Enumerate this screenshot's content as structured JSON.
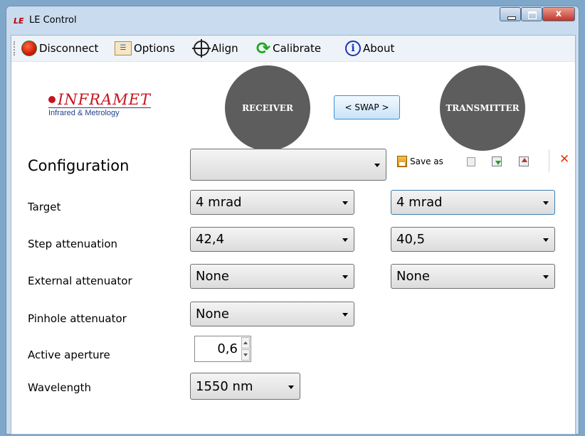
{
  "window": {
    "icon_text": "LE",
    "title": "LE Control"
  },
  "toolbar": {
    "disconnect_label": "Disconnect",
    "options_label": "Options",
    "align_label": "Align",
    "calibrate_label": "Calibrate",
    "about_label": "About",
    "about_icon_glyph": "i"
  },
  "logo": {
    "name": "INFRAMET",
    "tagline": "Infrared & Metrology"
  },
  "header": {
    "receiver_label": "RECEIVER",
    "swap_label": "< SWAP >",
    "transmitter_label": "TRANSMITTER"
  },
  "config": {
    "label": "Configuration",
    "value": "",
    "save_as_label": "Save as"
  },
  "rows": {
    "target": {
      "label": "Target",
      "receiver": "4 mrad",
      "transmitter": "4 mrad"
    },
    "step_attenuation": {
      "label": "Step attenuation",
      "receiver": "42,4",
      "transmitter": "40,5"
    },
    "external_attenuator": {
      "label": "External attenuator",
      "receiver": "None",
      "transmitter": "None"
    },
    "pinhole_attenuator": {
      "label": "Pinhole attenuator",
      "receiver": "None"
    },
    "active_aperture": {
      "label": "Active aperture",
      "value": "0,6"
    },
    "wavelength": {
      "label": "Wavelength",
      "value": "1550 nm"
    }
  },
  "icons": {
    "disconnect": "red-circle-icon",
    "options": "options-window-icon",
    "align": "crosshair-icon",
    "calibrate": "circular-arrows-icon",
    "about": "info-icon",
    "save": "save-as-icon",
    "delete": "delete-x-icon"
  },
  "colors": {
    "brand_red": "#c8141d",
    "brand_blue": "#243f8c",
    "circle_gray": "#5d5d5d",
    "calibrate_green": "#1fa81f",
    "delete_orange": "#e03a10"
  }
}
